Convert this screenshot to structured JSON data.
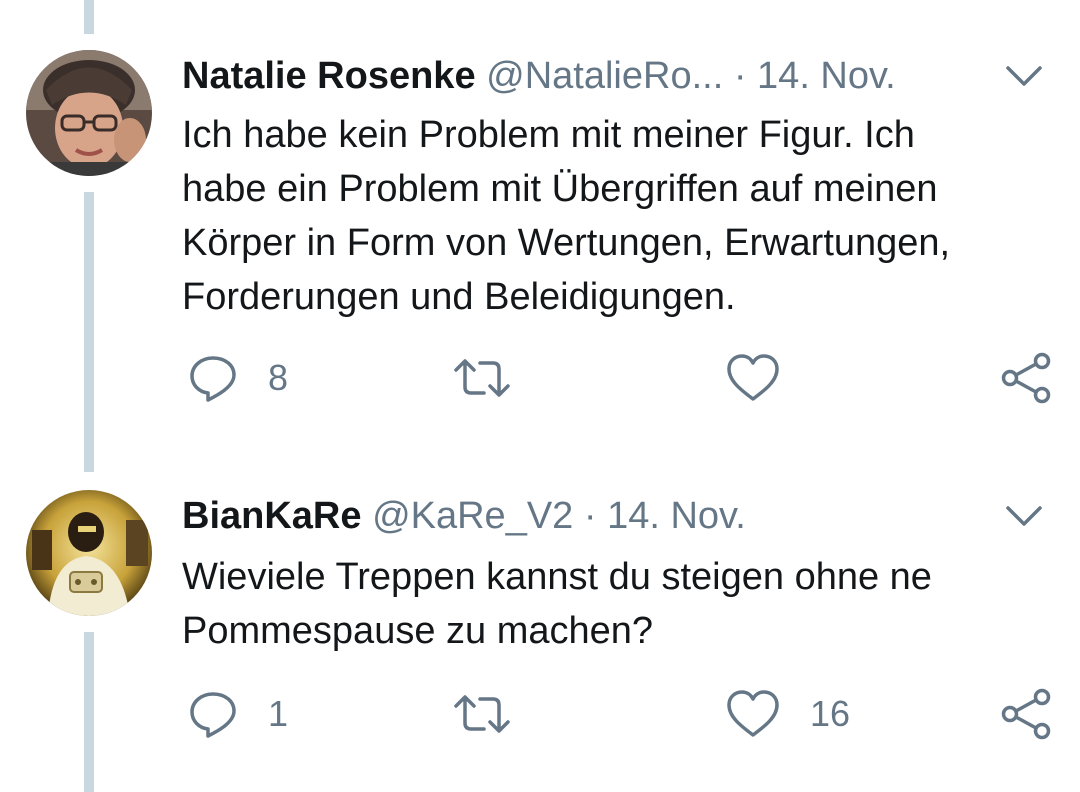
{
  "tweets": [
    {
      "name": "Natalie Rosenke",
      "handle": "@NatalieRo...",
      "separator": "·",
      "date": "14. Nov.",
      "text_lines": [
        "Ich habe kein Problem mit meiner Figur. Ich",
        "habe ein Problem mit Übergriffen auf meinen",
        "Körper in Form von Wertungen, Erwartungen,",
        "Forderungen und Beleidigungen."
      ],
      "reply_count": "8",
      "retweet_count": "",
      "like_count": ""
    },
    {
      "name": "BianKaRe",
      "handle": "@KaRe_V2",
      "separator": "·",
      "date": "14. Nov.",
      "text_lines": [
        "Wieviele Treppen kannst du steigen ohne ne",
        "Pommespause zu machen?"
      ],
      "reply_count": "1",
      "retweet_count": "",
      "like_count": "16"
    }
  ],
  "icons": {
    "reply": "reply-icon",
    "retweet": "retweet-icon",
    "like": "heart-icon",
    "share": "share-icon",
    "caret": "chevron-down-icon"
  },
  "colors": {
    "text": "#14171a",
    "secondary": "#657786",
    "thread_line": "#c9d7e0"
  }
}
